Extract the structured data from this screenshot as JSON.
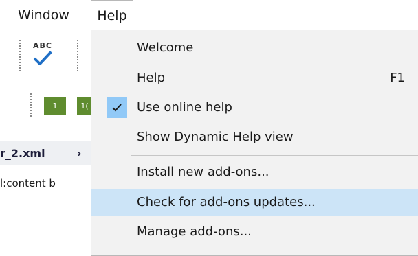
{
  "menubar": {
    "window_label": "Window",
    "help_label": "Help"
  },
  "toolbar": {
    "spell_label": "ABC",
    "page_button_1": "1",
    "page_button_2": "1("
  },
  "editor": {
    "breadcrumb_file": "r_2.xml",
    "breadcrumb_chevron": "›",
    "content_path": "l:content   b"
  },
  "help_menu": {
    "items": [
      {
        "label": "Welcome"
      },
      {
        "label": "Help",
        "shortcut": "F1"
      },
      {
        "label": "Use online help",
        "checked": true
      },
      {
        "label": "Show Dynamic Help view"
      },
      {
        "label": "Install new add-ons..."
      },
      {
        "label": "Check for add-ons updates...",
        "highlighted": true
      },
      {
        "label": "Manage add-ons..."
      }
    ]
  },
  "colors": {
    "menu_background": "#f2f2f2",
    "highlight": "#cce4f7",
    "check_background": "#91c9f7",
    "check_mark": "#1a1a1a",
    "toolbar_button_green": "#5f8c2f"
  }
}
